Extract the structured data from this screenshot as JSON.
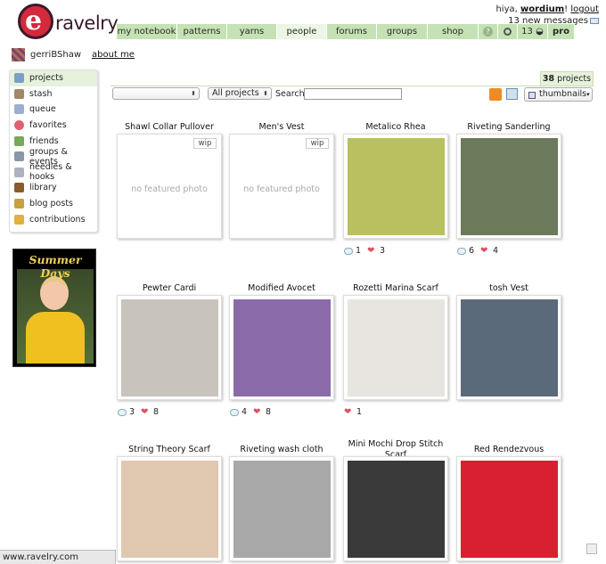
{
  "app": {
    "logo_text": "ravelry",
    "logo_letter": "e"
  },
  "user": {
    "greeting": "hiya,",
    "username": "wordium",
    "excl": "!",
    "logout": "logout",
    "messages": "13 new messages"
  },
  "nav": {
    "tabs": [
      {
        "label": "my notebook",
        "width": 68
      },
      {
        "label": "patterns",
        "width": 56
      },
      {
        "label": "yarns",
        "width": 56
      },
      {
        "label": "people",
        "width": 56
      },
      {
        "label": "forums",
        "width": 56
      },
      {
        "label": "groups",
        "width": 57
      },
      {
        "label": "shop",
        "width": 57
      }
    ],
    "help": "?",
    "count": "13",
    "pro": "pro"
  },
  "profile": {
    "name": "gerriBShaw",
    "about": "about me"
  },
  "sidebar": {
    "items": [
      {
        "label": "projects",
        "color": "#7aa0c8"
      },
      {
        "label": "stash",
        "color": "#a08868"
      },
      {
        "label": "queue",
        "color": "#9ab0d0"
      },
      {
        "label": "favorites",
        "color": "#e06070"
      },
      {
        "label": "friends",
        "color": "#78a858"
      },
      {
        "label": "groups & events",
        "color": "#8898a8"
      },
      {
        "label": "needles & hooks",
        "color": "#b0b0c0"
      },
      {
        "label": "library",
        "color": "#8a5a2a"
      },
      {
        "label": "blog posts",
        "color": "#c8a040"
      },
      {
        "label": "contributions",
        "color": "#e0b040"
      }
    ]
  },
  "ad": {
    "title": "Summer Days"
  },
  "filters": {
    "count_num": "38",
    "count_label": "projects",
    "select1": "",
    "select2": "All projects",
    "search_label": "Search",
    "search_placeholder": "",
    "view": "thumbnails"
  },
  "projects": [
    {
      "title": "Shawl Collar Pullover",
      "wip": "wip",
      "nophoto": "no featured photo"
    },
    {
      "title": "Men's Vest",
      "wip": "wip",
      "nophoto": "no featured photo"
    },
    {
      "title": "Metalico Rhea",
      "comments": "1",
      "hearts": "3",
      "bg": "#b8c060"
    },
    {
      "title": "Riveting Sanderling",
      "comments": "6",
      "hearts": "4",
      "bg": "#6a7a5a"
    },
    {
      "title": "Pewter Cardi",
      "comments": "3",
      "hearts": "8",
      "bg": "#c8c4bc"
    },
    {
      "title": "Modified Avocet",
      "comments": "4",
      "hearts": "8",
      "bg": "#8a6aa8"
    },
    {
      "title": "Rozetti Marina Scarf",
      "hearts": "1",
      "bg": "#e8e4e0"
    },
    {
      "title": "tosh Vest",
      "bg": "#5a6a7a"
    },
    {
      "title": "String Theory Scarf",
      "bg": "#e0c8b0"
    },
    {
      "title": "Riveting wash cloth",
      "bg": "#a8a8a8"
    },
    {
      "title": "Mini Mochi Drop Stitch Scarf",
      "bg": "#3a3a3a"
    },
    {
      "title": "Red Rendezvous",
      "bg": "#d82030"
    }
  ],
  "status": {
    "url": "www.ravelry.com"
  }
}
